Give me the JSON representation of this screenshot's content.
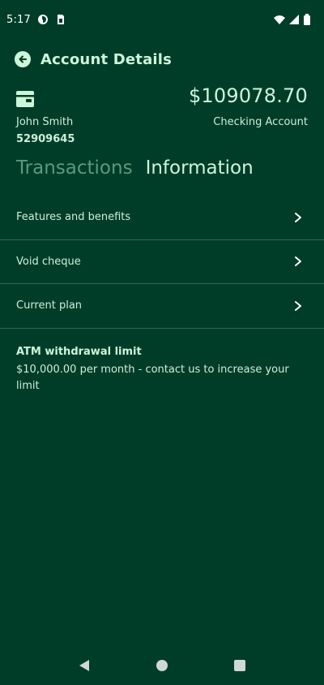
{
  "status_bar": {
    "time": "5:17",
    "icons": [
      "circle-status-icon",
      "sim-card-icon",
      "wifi-icon",
      "signal-icon",
      "battery-icon"
    ]
  },
  "header": {
    "title": "Account Details",
    "back_icon": "back-arrow-icon"
  },
  "account": {
    "icon": "wallet-icon",
    "holder_name": "John Smith",
    "number": "52909645",
    "balance": "$109078.70",
    "type": "Checking Account"
  },
  "tabs": [
    {
      "label": "Transactions",
      "active": false
    },
    {
      "label": "Information",
      "active": true
    }
  ],
  "menu": {
    "items": [
      {
        "label": "Features and benefits",
        "icon": "chevron-right-icon"
      },
      {
        "label": "Void cheque",
        "icon": "chevron-right-icon"
      },
      {
        "label": "Current plan",
        "icon": "chevron-right-icon"
      }
    ]
  },
  "limit": {
    "title": "ATM withdrawal limit",
    "text": "$10,000.00 per month - contact us to increase your limit"
  },
  "nav": {
    "buttons": [
      "back-triangle-icon",
      "home-circle-icon",
      "recents-square-icon"
    ]
  },
  "colors": {
    "background": "#003d29",
    "accent": "#cdf5d9",
    "inactive_tab": "#5a9a7c",
    "divider": "#2f6a52"
  }
}
